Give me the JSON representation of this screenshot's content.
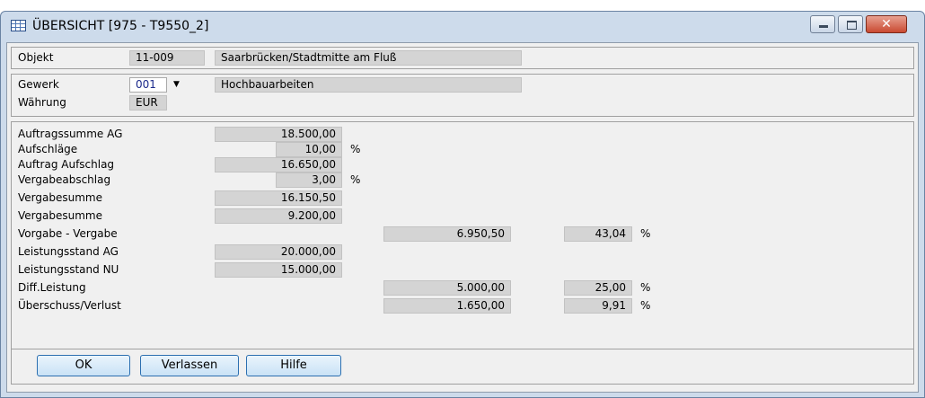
{
  "window": {
    "title": "ÜBERSICHT  [975 - T9550_2]",
    "icons": {
      "app": "table-icon",
      "minimize": "minimize-icon",
      "maximize": "maximize-icon",
      "close": "close-icon"
    }
  },
  "objekt": {
    "label": "Objekt",
    "code": "11-009",
    "name": "Saarbrücken/Stadtmitte am Fluß"
  },
  "gewerk": {
    "label": "Gewerk",
    "code": "001",
    "dropdown_glyph": "▼",
    "name": "Hochbauarbeiten"
  },
  "waehrung": {
    "label": "Währung",
    "value": "EUR"
  },
  "figures": {
    "auftragssumme_ag": {
      "label": "Auftragssumme AG",
      "value": "18.500,00"
    },
    "aufschlaege": {
      "label": "Aufschläge",
      "value": "10,00",
      "unit": "%"
    },
    "auftrag_aufschlag": {
      "label": "Auftrag Aufschlag",
      "value": "16.650,00"
    },
    "vergabeabschlag": {
      "label": "Vergabeabschlag",
      "value": "3,00",
      "unit": "%"
    },
    "vergabesumme_1": {
      "label": "Vergabesumme",
      "value": "16.150,50"
    },
    "vergabesumme_2": {
      "label": "Vergabesumme",
      "value": "9.200,00"
    },
    "vorgabe_vergabe": {
      "label": "Vorgabe - Vergabe",
      "value": "6.950,50",
      "percent": "43,04",
      "unit": "%"
    },
    "leistungsstand_ag": {
      "label": "Leistungsstand AG",
      "value": "20.000,00"
    },
    "leistungsstand_nu": {
      "label": "Leistungsstand NU",
      "value": "15.000,00"
    },
    "diff_leistung": {
      "label": "Diff.Leistung",
      "value": "5.000,00",
      "percent": "25,00",
      "unit": "%"
    },
    "ueberschuss_verlust": {
      "label": "Überschuss/Verlust",
      "value": "1.650,00",
      "percent": "9,91",
      "unit": "%"
    }
  },
  "buttons": {
    "ok": "OK",
    "verlassen": "Verlassen",
    "hilfe": "Hilfe"
  },
  "colors": {
    "field_bg": "#d4d4d4",
    "input_text": "#1c2a8c",
    "button_border": "#2c6fb0",
    "close_button": "#c94a31"
  }
}
